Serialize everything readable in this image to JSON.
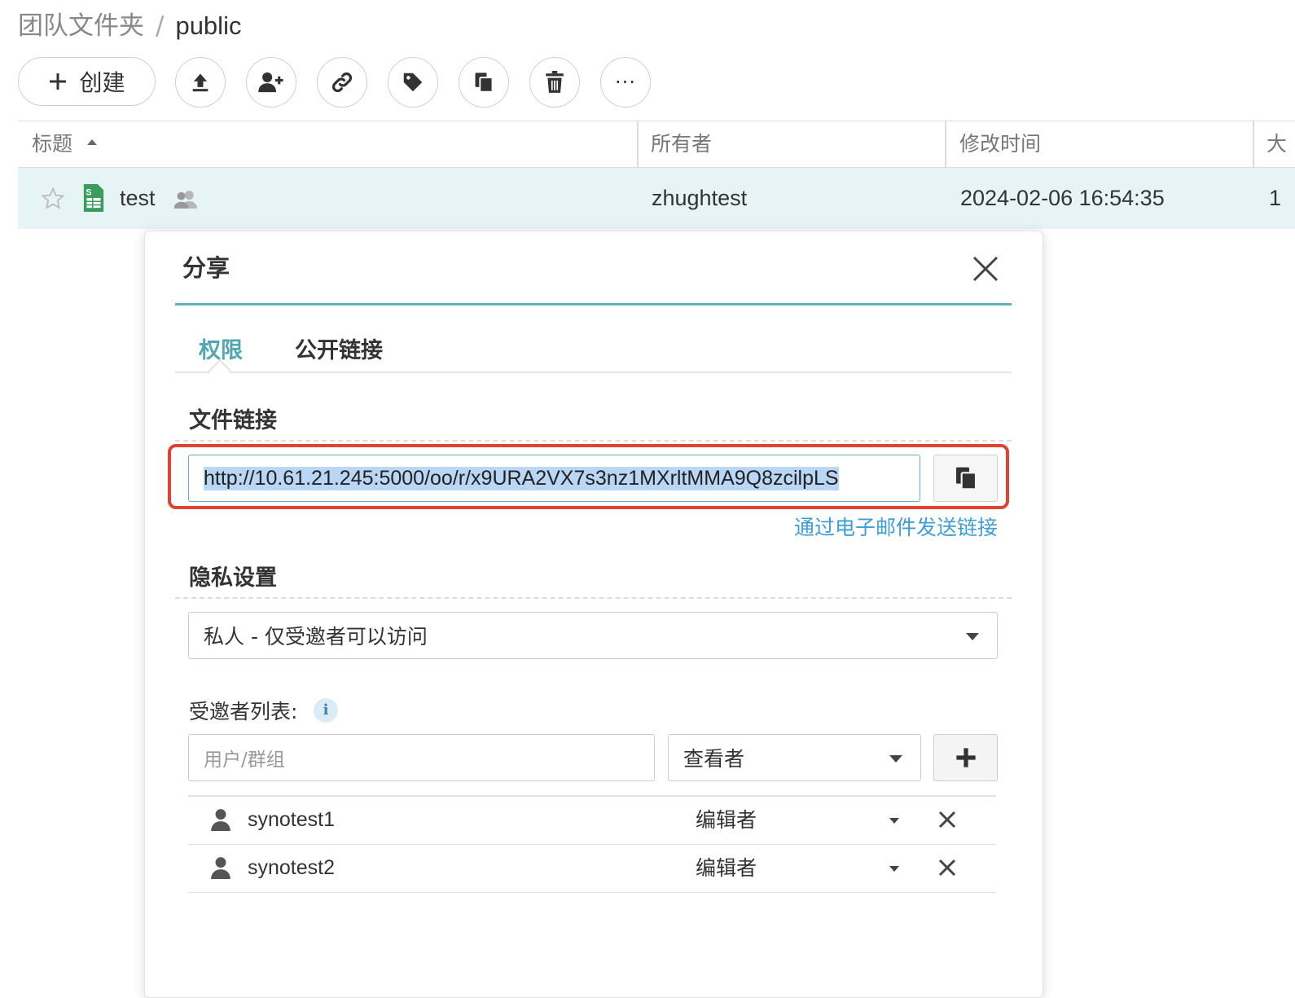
{
  "breadcrumb": {
    "parent": "团队文件夹",
    "separator": "/",
    "current": "public"
  },
  "toolbar": {
    "create_label": "创建",
    "buttons": [
      "upload-icon",
      "add-user-icon",
      "link-icon",
      "tag-icon",
      "copy-icon",
      "trash-icon",
      "more-icon"
    ],
    "more_label": "···"
  },
  "table": {
    "columns": {
      "title": "标题",
      "owner": "所有者",
      "modified": "修改时间",
      "size_cut": "大"
    },
    "rows": [
      {
        "title": "test",
        "owner": "zhughtest",
        "modified": "2024-02-06 16:54:35",
        "size_cut": "1"
      }
    ]
  },
  "dialog": {
    "title": "分享",
    "tabs": [
      {
        "label": "权限",
        "active": true
      },
      {
        "label": "公开链接",
        "active": false
      }
    ],
    "file_link": {
      "heading": "文件链接",
      "url": "http://10.61.21.245:5000/oo/r/x9URA2VX7s3nz1MXrltMMA9Q8zcilpLS",
      "email_link": "通过电子邮件发送链接"
    },
    "privacy": {
      "heading": "隐私设置",
      "selected": "私人 - 仅受邀者可以访问"
    },
    "invitees": {
      "label": "受邀者列表:",
      "info_icon": "i",
      "input_placeholder": "用户/群组",
      "role_selected": "查看者",
      "list": [
        {
          "name": "synotest1",
          "role": "编辑者"
        },
        {
          "name": "synotest2",
          "role": "编辑者"
        }
      ]
    }
  },
  "colors": {
    "accent": "#5fb3bf",
    "link": "#3d9fd6",
    "highlight_border": "#e0432f",
    "selected_row": "#e7f4f6"
  }
}
